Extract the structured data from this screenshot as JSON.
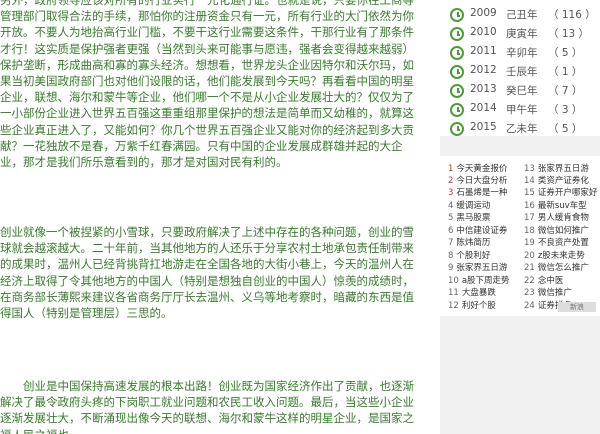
{
  "article": {
    "paragraphs": [
      "另外，政府领导应该对所有的行业实行一元化通行证。也就是说，只要你在工商等管理部门取得合法的手续，那怕你的注册资金只有一元，所有行业的大门依然为你开放。不要人为地抬高行业门槛，不要干这行业需要这条件，干那行业有了那条件才行！这实质是保护强者更强（当然到头来可能事与愿违，强者会变得越来越弱）保护垄断，形成曲高和寡的寡头经济。想想看，世界龙头企业因特尔和沃尔玛，如果当初美国政府部门也对他们设限的话，他们能发展到今天吗？再看看中国的明星企业，联想、海尔和蒙牛等企业，他们哪一个不是从小企业发展壮大的？仅仅为了一小部份企业进入世界五百强这重重组那里保护的想法是简单而又幼稚的，就算这些企业真正进入了，又能如何？你几个世界五百强企业又能对你的经济起到多大贡献？一花独放不是春，万紫千红春满园。只有中国的企业发展成群雄并起的大企业，那才是我们所乐意看到的，那才是对国对民有利的。",
      "创业就像一个被捏紧的小雪球，只要政府解决了上述中存在的各种问题，创业的雪球就会越滚越大。二十年前，当其他地方的人还乐于分享农村土地承包责任制带来的成果时，温州人已经背挑背扛地游走在全国各地的大街小巷上，今天的温州人在经济上取得了令其他地方的中国人（特别是想独自创业的中国人）惊羡的成绩时，在商务部长薄熙来建议各省商务厅厅长去温州、义乌等地考察时，暗藏的东西是值得国人（特别是管理层）三思的。",
      "　　创业是中国保持高速发展的根本出路！创业既为国家经济作出了贡献，也逐渐解决了最令政府头疼的下岗职工就业问题和农民工收入问题。最后，当这些小企业逐渐发展壮大，不断涌现出像今天的联想、海尔和蒙牛这样的明星企业，是国家之福人民之福也"
    ]
  },
  "archive": [
    {
      "year": "2009",
      "ganzhi": "己丑年",
      "count": "（ 116 ）"
    },
    {
      "year": "2010",
      "ganzhi": "庚寅年",
      "count": "（ 13 ）"
    },
    {
      "year": "2011",
      "ganzhi": "辛卯年",
      "count": "（ 5 ）"
    },
    {
      "year": "2012",
      "ganzhi": "壬辰年",
      "count": "（ 1 ）"
    },
    {
      "year": "2013",
      "ganzhi": "癸巳年",
      "count": "（ 7 ）"
    },
    {
      "year": "2014",
      "ganzhi": "甲午年",
      "count": "（ 3 ）"
    },
    {
      "year": "2015",
      "ganzhi": "乙未年",
      "count": "（ 5 ）"
    }
  ],
  "hot_list": [
    {
      "n": "1",
      "t": "今天黄金报价"
    },
    {
      "n": "2",
      "t": "今日大盘分析"
    },
    {
      "n": "3",
      "t": "石墨烯是一种"
    },
    {
      "n": "4",
      "t": "缓调运动"
    },
    {
      "n": "5",
      "t": "黑马股票"
    },
    {
      "n": "6",
      "t": "中信建设证券"
    },
    {
      "n": "7",
      "t": "陈炜简历"
    },
    {
      "n": "8",
      "t": "个股利好"
    },
    {
      "n": "9",
      "t": "张家界五日游"
    },
    {
      "n": "10",
      "t": "a股下周走势"
    },
    {
      "n": "11",
      "t": "大盘暴跌"
    },
    {
      "n": "12",
      "t": "利好个股"
    },
    {
      "n": "13",
      "t": "张家界五日游"
    },
    {
      "n": "14",
      "t": "类资产证券化"
    },
    {
      "n": "15",
      "t": "证券开户哪家好"
    },
    {
      "n": "16",
      "t": "最新suv车型"
    },
    {
      "n": "17",
      "t": "男人缓肯食物"
    },
    {
      "n": "18",
      "t": "微信如何推广"
    },
    {
      "n": "19",
      "t": "不良资产处置"
    },
    {
      "n": "20",
      "t": "z股未来走势"
    },
    {
      "n": "21",
      "t": "微信怎么推广"
    },
    {
      "n": "22",
      "t": "念中医"
    },
    {
      "n": "23",
      "t": "微信推广"
    },
    {
      "n": "24",
      "t": "证券排名"
    }
  ],
  "badge": "新浪"
}
